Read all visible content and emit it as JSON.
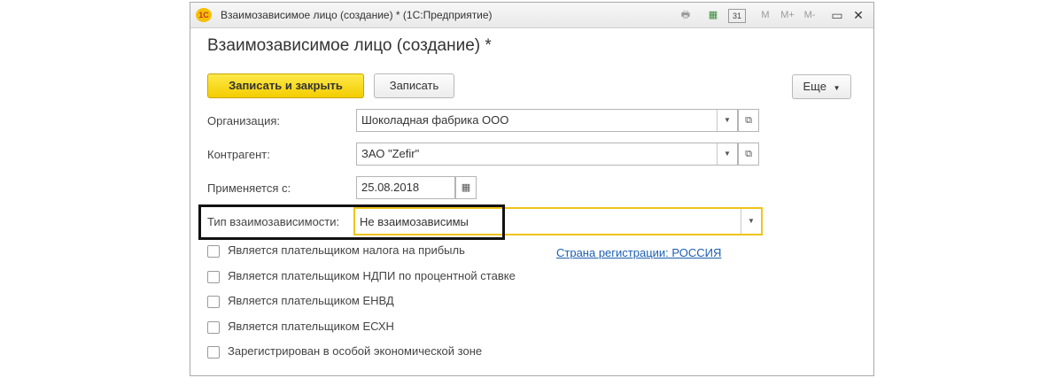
{
  "window": {
    "title": "Взаимозависимое лицо (создание) * (1С:Предприятие)",
    "logo_text": "1С",
    "toolbar_icons": [
      "print-icon",
      "calculator-icon",
      "calendar-icon",
      "memory-m-icon",
      "memory-mplus-icon",
      "memory-mminus-icon",
      "restore-icon",
      "close-icon"
    ],
    "toolbar_glyphs": {
      "print": "🖶",
      "calc": "▦",
      "calendar": "31",
      "m": "M",
      "mplus": "M+",
      "mminus": "M-",
      "restore": "▭",
      "close": "✕"
    }
  },
  "form": {
    "title": "Взаимозависимое лицо (создание) *",
    "buttons": {
      "save_close": "Записать и закрыть",
      "save": "Записать",
      "more": "Еще"
    },
    "fields": {
      "organization": {
        "label": "Организация:",
        "value": "Шоколадная фабрика ООО"
      },
      "counterparty": {
        "label": "Контрагент:",
        "value": "ЗАО \"Zefir\""
      },
      "applies_from": {
        "label": "Применяется с:",
        "value": "25.08.2018"
      },
      "dependency_type": {
        "label": "Тип взаимозависимости:",
        "value": "Не взаимозависимы"
      }
    },
    "registration_link": "Страна регистрации: РОССИЯ",
    "checkboxes": [
      {
        "label": "Является плательщиком налога на прибыль",
        "checked": false
      },
      {
        "label": "Является плательщиком НДПИ по процентной ставке",
        "checked": false
      },
      {
        "label": "Является плательщиком ЕНВД",
        "checked": false
      },
      {
        "label": "Является плательщиком ЕСХН",
        "checked": false
      },
      {
        "label": "Зарегистрирован в особой экономической зоне",
        "checked": false
      }
    ]
  },
  "colors": {
    "primary_button": "#f3cd00",
    "active_field_border": "#f0c419",
    "link": "#1d5fb1",
    "highlight_frame": "#111111"
  }
}
